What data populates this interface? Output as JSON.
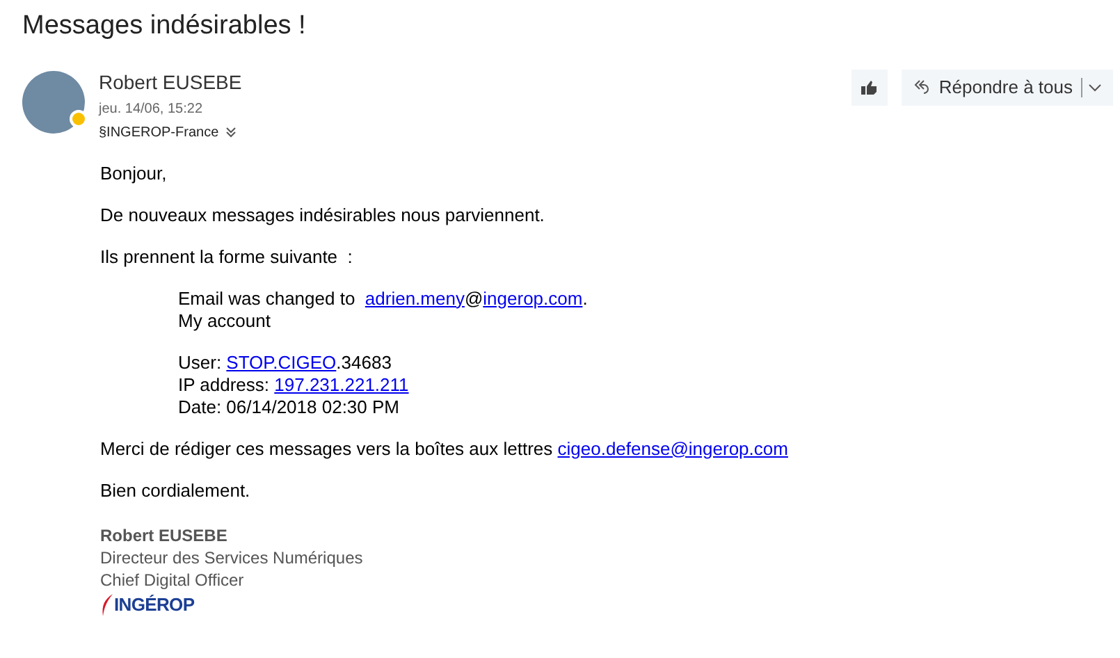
{
  "subject": "Messages indésirables !",
  "sender": {
    "name": "Robert EUSEBE",
    "date": "jeu. 14/06, 15:22",
    "to": "§INGEROP-France",
    "away": true
  },
  "actions": {
    "reply_all": "Répondre à tous"
  },
  "body": [
    {
      "kind": "para",
      "parts": [
        {
          "kind": "text",
          "text": "Bonjour,"
        }
      ]
    },
    {
      "kind": "para",
      "parts": [
        {
          "kind": "text",
          "text": "De nouveaux messages indésirables nous parviennent."
        }
      ]
    },
    {
      "kind": "para",
      "parts": [
        {
          "kind": "text",
          "text": "Ils prennent la forme suivante  :"
        }
      ]
    },
    {
      "kind": "quote",
      "parts": [
        {
          "kind": "text",
          "text": "Email was changed to  "
        },
        {
          "kind": "link",
          "text": "adrien.meny"
        },
        {
          "kind": "text",
          "text": "@"
        },
        {
          "kind": "link",
          "text": "ingerop.com"
        },
        {
          "kind": "text",
          "text": "."
        }
      ]
    },
    {
      "kind": "quote_line",
      "parts": [
        {
          "kind": "text",
          "text": "My account"
        }
      ]
    },
    {
      "kind": "quote",
      "parts": [
        {
          "kind": "text",
          "text": "User: "
        },
        {
          "kind": "link",
          "text": "STOP.CIGEO"
        },
        {
          "kind": "text",
          "text": ".34683"
        }
      ]
    },
    {
      "kind": "quote_line",
      "parts": [
        {
          "kind": "text",
          "text": "IP address: "
        },
        {
          "kind": "link",
          "text": "197.231.221.211"
        }
      ]
    },
    {
      "kind": "quote_line",
      "parts": [
        {
          "kind": "text",
          "text": "Date: 06/14/2018 02:30 PM"
        }
      ]
    },
    {
      "kind": "para",
      "parts": [
        {
          "kind": "text",
          "text": "Merci de rédiger ces messages vers la boîtes aux lettres "
        },
        {
          "kind": "link",
          "text": "cigeo.defense@ingerop.com"
        }
      ]
    },
    {
      "kind": "para",
      "parts": [
        {
          "kind": "text",
          "text": "Bien cordialement."
        }
      ]
    }
  ],
  "signature": {
    "name": "Robert EUSEBE",
    "lines": [
      "Directeur des Services Numériques",
      "Chief Digital Officer"
    ],
    "logo": "INGÉROP"
  }
}
